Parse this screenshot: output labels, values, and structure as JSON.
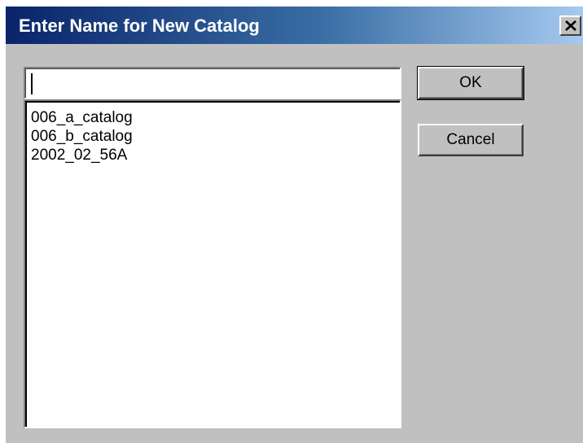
{
  "window": {
    "title": "Enter Name for New Catalog",
    "close_icon": "close-icon"
  },
  "name_input": {
    "value": "",
    "placeholder": ""
  },
  "catalogs": [
    "006_a_catalog",
    "006_b_catalog",
    "2002_02_56A"
  ],
  "buttons": {
    "ok_label": "OK",
    "cancel_label": "Cancel"
  },
  "colors": {
    "title_bar_start": "#0a246a",
    "title_bar_end": "#a6caf0",
    "dialog_background": "#c0c0c0"
  }
}
